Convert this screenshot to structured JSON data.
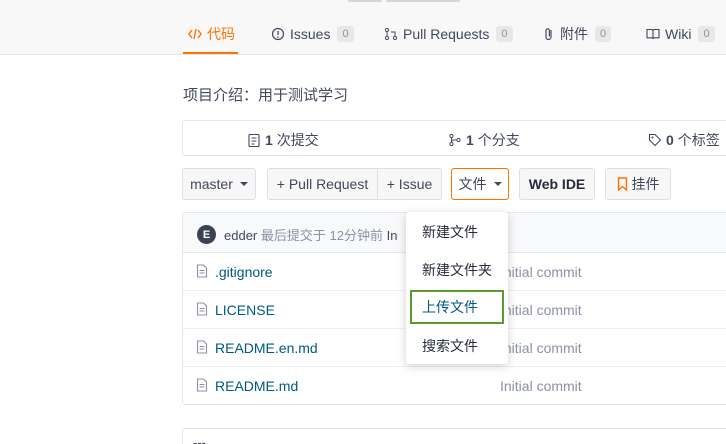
{
  "tabs": [
    {
      "label": "代码",
      "count": null
    },
    {
      "label": "Issues",
      "count": "0"
    },
    {
      "label": "Pull Requests",
      "count": "0"
    },
    {
      "label": "附件",
      "count": "0"
    },
    {
      "label": "Wiki",
      "count": "0"
    }
  ],
  "colors": {
    "accent": "#fe7300",
    "link": "#005980",
    "highlight_border": "#5a9b2e"
  },
  "intro": "项目介绍：用于测试学习",
  "stats": {
    "commits_count": "1",
    "commits_label": "次提交",
    "branches_count": "1",
    "branches_label": "个分支",
    "tags_count": "0",
    "tags_label": "个标签"
  },
  "toolbar": {
    "branch": "master",
    "pull_request": "+ Pull Request",
    "issue": "+ Issue",
    "file": "文件",
    "web_ide": "Web IDE",
    "pin": "挂件"
  },
  "commit": {
    "avatar_letter": "E",
    "author": "edder",
    "meta": "最后提交于 12分钟前",
    "message": "In"
  },
  "files": [
    {
      "name": ".gitignore",
      "message": "Initial commit"
    },
    {
      "name": "LICENSE",
      "message": "Initial commit"
    },
    {
      "name": "README.en.md",
      "message": "Initial commit"
    },
    {
      "name": "README.md",
      "message": "Initial commit"
    }
  ],
  "file_menu": [
    "新建文件",
    "新建文件夹",
    "上传文件",
    "搜索文件"
  ],
  "bottom_text": "---",
  "icons": [
    "code-icon",
    "issue-icon",
    "pull-request-icon",
    "attachment-icon",
    "wiki-icon",
    "commit-icon",
    "branch-icon",
    "tag-icon",
    "bookmark-icon",
    "file-icon"
  ]
}
